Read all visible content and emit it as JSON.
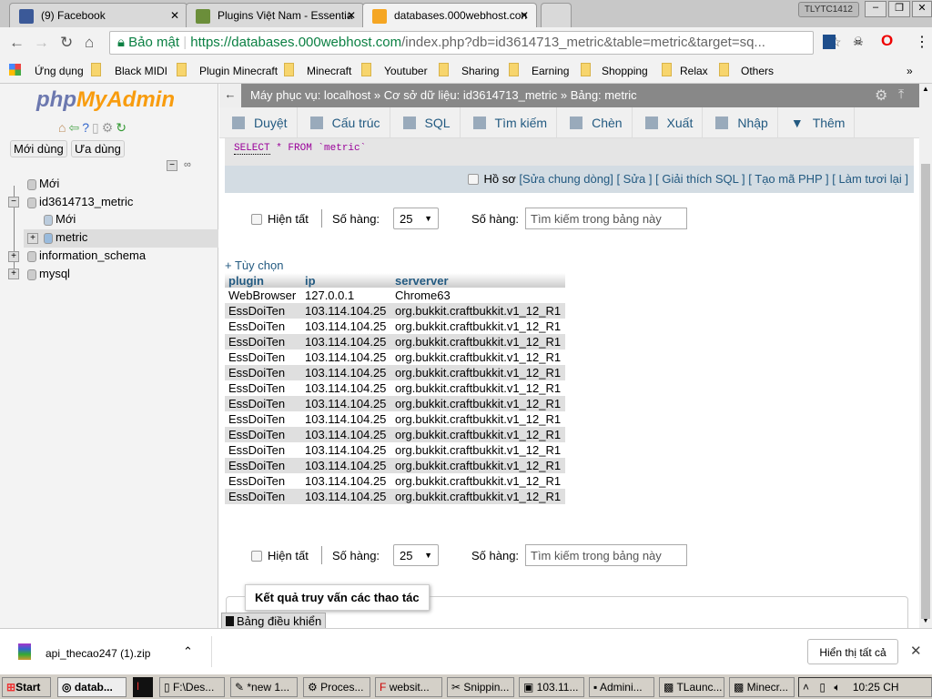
{
  "browser": {
    "tabs": [
      {
        "label": "(9) Facebook",
        "icon": "facebook-icon"
      },
      {
        "label": "Plugins Việt Nam - Essentia",
        "icon": "minecraft-icon"
      },
      {
        "label": "databases.000webhost.con",
        "icon": "pma-icon",
        "active": true
      }
    ],
    "profile": "TLYTC1412",
    "secure_label": "Bảo mật",
    "url_host": "https://databases.000webhost.com",
    "url_path": "/index.php?db=id3614713_metric&table=metric&target=sq...",
    "bookmarks": [
      "Ứng dụng",
      "Black MIDI",
      "Plugin Minecraft",
      "Minecraft",
      "Youtuber",
      "Sharing",
      "Earning",
      "Shopping",
      "Relax",
      "Others"
    ]
  },
  "sidebar": {
    "logo_php": "php",
    "logo_my": "MyAdmin",
    "btn_recent": "Mới dùng",
    "btn_fav": "Ưa dùng",
    "tree": [
      {
        "label": "Mới"
      },
      {
        "label": "id3614713_metric"
      },
      {
        "label": "Mới"
      },
      {
        "label": "metric"
      },
      {
        "label": "information_schema"
      },
      {
        "label": "mysql"
      }
    ]
  },
  "breadcrumb": {
    "server": "Máy phục vụ: localhost »",
    "db": "Cơ sở dữ liệu: id3614713_metric »",
    "table": "Bảng: metric"
  },
  "menu": [
    "Duyệt",
    "Cấu trúc",
    "SQL",
    "Tìm kiếm",
    "Chèn",
    "Xuất",
    "Nhập",
    "Thêm"
  ],
  "sql": {
    "kw1": "SELECT",
    "rest": " * FROM `metric`"
  },
  "sqlbar": {
    "profile": "Hồ sơ",
    "inline": "[Sửa chung dòng]",
    "edit": "[ Sửa ]",
    "explain": "[ Giải thích SQL ]",
    "php": "[ Tạo mã PHP ]",
    "refresh": "[ Làm tươi lại ]"
  },
  "nav": {
    "show_all": "Hiện tất",
    "rows_label": "Số hàng:",
    "rows_value": "25",
    "filter_label": "Số hàng:",
    "filter_placeholder": "Tìm kiếm trong bảng này"
  },
  "options": "+ Tùy chọn",
  "table": {
    "columns": [
      "plugin",
      "ip",
      "serverver"
    ],
    "rows": [
      [
        "WebBrowser",
        "127.0.0.1",
        "Chrome63"
      ],
      [
        "EssDoiTen",
        "103.114.104.25",
        "org.bukkit.craftbukkit.v1_12_R1"
      ],
      [
        "EssDoiTen",
        "103.114.104.25",
        "org.bukkit.craftbukkit.v1_12_R1"
      ],
      [
        "EssDoiTen",
        "103.114.104.25",
        "org.bukkit.craftbukkit.v1_12_R1"
      ],
      [
        "EssDoiTen",
        "103.114.104.25",
        "org.bukkit.craftbukkit.v1_12_R1"
      ],
      [
        "EssDoiTen",
        "103.114.104.25",
        "org.bukkit.craftbukkit.v1_12_R1"
      ],
      [
        "EssDoiTen",
        "103.114.104.25",
        "org.bukkit.craftbukkit.v1_12_R1"
      ],
      [
        "EssDoiTen",
        "103.114.104.25",
        "org.bukkit.craftbukkit.v1_12_R1"
      ],
      [
        "EssDoiTen",
        "103.114.104.25",
        "org.bukkit.craftbukkit.v1_12_R1"
      ],
      [
        "EssDoiTen",
        "103.114.104.25",
        "org.bukkit.craftbukkit.v1_12_R1"
      ],
      [
        "EssDoiTen",
        "103.114.104.25",
        "org.bukkit.craftbukkit.v1_12_R1"
      ],
      [
        "EssDoiTen",
        "103.114.104.25",
        "org.bukkit.craftbukkit.v1_12_R1"
      ],
      [
        "EssDoiTen",
        "103.114.104.25",
        "org.bukkit.craftbukkit.v1_12_R1"
      ],
      [
        "EssDoiTen",
        "103.114.104.25",
        "org.bukkit.craftbukkit.v1_12_R1"
      ]
    ]
  },
  "results_legend": "Kết quả truy vấn các thao tác",
  "console": "Bảng điều khiển",
  "download": {
    "file": "api_thecao247 (1).zip",
    "show_all": "Hiển thị tất cả"
  },
  "taskbar": {
    "start": "Start",
    "items": [
      "datab...",
      "F:\\Des...",
      "*new 1...",
      "Proces...",
      "websit...",
      "Snippin...",
      "103.11...",
      "Admini...",
      "TLaunc...",
      "Minecr..."
    ],
    "clock": "10:25 CH"
  }
}
